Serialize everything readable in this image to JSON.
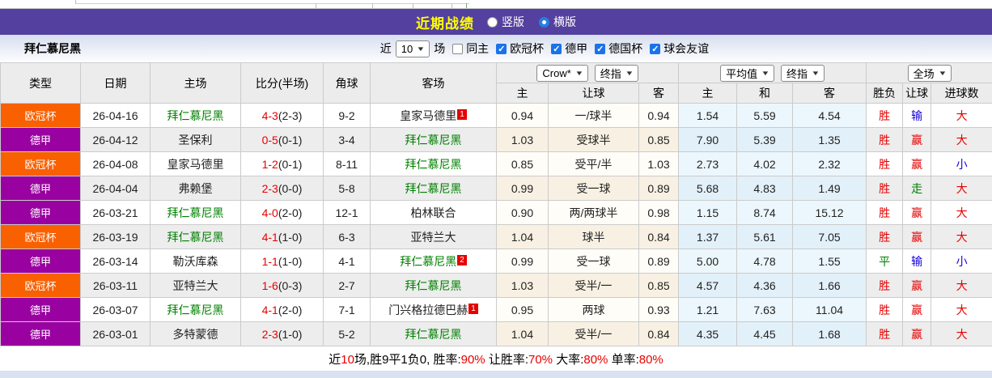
{
  "header": {
    "title": "近期战绩",
    "view_options": [
      {
        "label": "竖版",
        "selected": false
      },
      {
        "label": "横版",
        "selected": true
      }
    ]
  },
  "filter": {
    "team": "拜仁慕尼黑",
    "near": "近",
    "count": "10",
    "unit": "场",
    "same_home": {
      "label": "同主",
      "checked": false
    },
    "leagues": [
      {
        "label": "欧冠杯",
        "checked": true
      },
      {
        "label": "德甲",
        "checked": true
      },
      {
        "label": "德国杯",
        "checked": true
      },
      {
        "label": "球会友谊",
        "checked": true
      }
    ]
  },
  "table": {
    "selects": {
      "odds_source": "Crow*",
      "final1": "终指",
      "average": "平均值",
      "final2": "终指",
      "scope": "全场"
    },
    "main_columns": [
      "类型",
      "日期",
      "主场",
      "比分(半场)",
      "角球",
      "客场"
    ],
    "sub_columns": [
      "主",
      "让球",
      "客",
      "主",
      "和",
      "客",
      "胜负",
      "让球",
      "进球数"
    ],
    "rows": [
      {
        "league": "欧冠杯",
        "lg": "ucl",
        "date": "26-04-16",
        "home": "拜仁慕尼黑",
        "home_c": "green",
        "home_sup": "",
        "score": "4-3",
        "half": "(2-3)",
        "corner": "9-2",
        "away": "皇家马德里",
        "away_c": "",
        "away_sup": "1",
        "odds": [
          "0.94",
          "一/球半",
          "0.94"
        ],
        "avg": [
          "1.54",
          "5.59",
          "4.54"
        ],
        "res": [
          {
            "t": "胜",
            "c": "red"
          },
          {
            "t": "输",
            "c": "blue"
          },
          {
            "t": "大",
            "c": "red"
          }
        ]
      },
      {
        "league": "德甲",
        "lg": "bund",
        "date": "26-04-12",
        "home": "圣保利",
        "home_c": "",
        "home_sup": "",
        "score": "0-5",
        "half": "(0-1)",
        "corner": "3-4",
        "away": "拜仁慕尼黑",
        "away_c": "green",
        "away_sup": "",
        "odds": [
          "1.03",
          "受球半",
          "0.85"
        ],
        "avg": [
          "7.90",
          "5.39",
          "1.35"
        ],
        "res": [
          {
            "t": "胜",
            "c": "red"
          },
          {
            "t": "赢",
            "c": "red"
          },
          {
            "t": "大",
            "c": "red"
          }
        ]
      },
      {
        "league": "欧冠杯",
        "lg": "ucl",
        "date": "26-04-08",
        "home": "皇家马德里",
        "home_c": "",
        "home_sup": "",
        "score": "1-2",
        "half": "(0-1)",
        "corner": "8-11",
        "away": "拜仁慕尼黑",
        "away_c": "green",
        "away_sup": "",
        "odds": [
          "0.85",
          "受平/半",
          "1.03"
        ],
        "avg": [
          "2.73",
          "4.02",
          "2.32"
        ],
        "res": [
          {
            "t": "胜",
            "c": "red"
          },
          {
            "t": "赢",
            "c": "red"
          },
          {
            "t": "小",
            "c": "blue"
          }
        ]
      },
      {
        "league": "德甲",
        "lg": "bund",
        "date": "26-04-04",
        "home": "弗赖堡",
        "home_c": "",
        "home_sup": "",
        "score": "2-3",
        "half": "(0-0)",
        "corner": "5-8",
        "away": "拜仁慕尼黑",
        "away_c": "green",
        "away_sup": "",
        "odds": [
          "0.99",
          "受一球",
          "0.89"
        ],
        "avg": [
          "5.68",
          "4.83",
          "1.49"
        ],
        "res": [
          {
            "t": "胜",
            "c": "red"
          },
          {
            "t": "走",
            "c": "green"
          },
          {
            "t": "大",
            "c": "red"
          }
        ]
      },
      {
        "league": "德甲",
        "lg": "bund",
        "date": "26-03-21",
        "home": "拜仁慕尼黑",
        "home_c": "green",
        "home_sup": "",
        "score": "4-0",
        "half": "(2-0)",
        "corner": "12-1",
        "away": "柏林联合",
        "away_c": "",
        "away_sup": "",
        "odds": [
          "0.90",
          "两/两球半",
          "0.98"
        ],
        "avg": [
          "1.15",
          "8.74",
          "15.12"
        ],
        "res": [
          {
            "t": "胜",
            "c": "red"
          },
          {
            "t": "赢",
            "c": "red"
          },
          {
            "t": "大",
            "c": "red"
          }
        ]
      },
      {
        "league": "欧冠杯",
        "lg": "ucl",
        "date": "26-03-19",
        "home": "拜仁慕尼黑",
        "home_c": "green",
        "home_sup": "",
        "score": "4-1",
        "half": "(1-0)",
        "corner": "6-3",
        "away": "亚特兰大",
        "away_c": "",
        "away_sup": "",
        "odds": [
          "1.04",
          "球半",
          "0.84"
        ],
        "avg": [
          "1.37",
          "5.61",
          "7.05"
        ],
        "res": [
          {
            "t": "胜",
            "c": "red"
          },
          {
            "t": "赢",
            "c": "red"
          },
          {
            "t": "大",
            "c": "red"
          }
        ]
      },
      {
        "league": "德甲",
        "lg": "bund",
        "date": "26-03-14",
        "home": "勒沃库森",
        "home_c": "",
        "home_sup": "",
        "score": "1-1",
        "half": "(1-0)",
        "corner": "4-1",
        "away": "拜仁慕尼黑",
        "away_c": "green",
        "away_sup": "2",
        "odds": [
          "0.99",
          "受一球",
          "0.89"
        ],
        "avg": [
          "5.00",
          "4.78",
          "1.55"
        ],
        "res": [
          {
            "t": "平",
            "c": "green"
          },
          {
            "t": "输",
            "c": "blue"
          },
          {
            "t": "小",
            "c": "blue"
          }
        ]
      },
      {
        "league": "欧冠杯",
        "lg": "ucl",
        "date": "26-03-11",
        "home": "亚特兰大",
        "home_c": "",
        "home_sup": "",
        "score": "1-6",
        "half": "(0-3)",
        "corner": "2-7",
        "away": "拜仁慕尼黑",
        "away_c": "green",
        "away_sup": "",
        "odds": [
          "1.03",
          "受半/一",
          "0.85"
        ],
        "avg": [
          "4.57",
          "4.36",
          "1.66"
        ],
        "res": [
          {
            "t": "胜",
            "c": "red"
          },
          {
            "t": "赢",
            "c": "red"
          },
          {
            "t": "大",
            "c": "red"
          }
        ]
      },
      {
        "league": "德甲",
        "lg": "bund",
        "date": "26-03-07",
        "home": "拜仁慕尼黑",
        "home_c": "green",
        "home_sup": "",
        "score": "4-1",
        "half": "(2-0)",
        "corner": "7-1",
        "away": "门兴格拉德巴赫",
        "away_c": "",
        "away_sup": "1",
        "odds": [
          "0.95",
          "两球",
          "0.93"
        ],
        "avg": [
          "1.21",
          "7.63",
          "11.04"
        ],
        "res": [
          {
            "t": "胜",
            "c": "red"
          },
          {
            "t": "赢",
            "c": "red"
          },
          {
            "t": "大",
            "c": "red"
          }
        ]
      },
      {
        "league": "德甲",
        "lg": "bund",
        "date": "26-03-01",
        "home": "多特蒙德",
        "home_c": "",
        "home_sup": "",
        "score": "2-3",
        "half": "(1-0)",
        "corner": "5-2",
        "away": "拜仁慕尼黑",
        "away_c": "green",
        "away_sup": "",
        "odds": [
          "1.04",
          "受半/一",
          "0.84"
        ],
        "avg": [
          "4.35",
          "4.45",
          "1.68"
        ],
        "res": [
          {
            "t": "胜",
            "c": "red"
          },
          {
            "t": "赢",
            "c": "red"
          },
          {
            "t": "大",
            "c": "red"
          }
        ]
      }
    ]
  },
  "footer": {
    "parts": [
      {
        "t": "近",
        "c": "k"
      },
      {
        "t": "10",
        "c": "r"
      },
      {
        "t": "场,胜9平1负0, 胜率:",
        "c": "k"
      },
      {
        "t": "90%",
        "c": "r"
      },
      {
        "t": " 让胜率:",
        "c": "k"
      },
      {
        "t": "70%",
        "c": "r"
      },
      {
        "t": " 大率:",
        "c": "k"
      },
      {
        "t": "80%",
        "c": "r"
      },
      {
        "t": " 单率:",
        "c": "k"
      },
      {
        "t": "80%",
        "c": "r"
      }
    ]
  },
  "colors": {
    "bar_purple": "#54409e",
    "title_yellow": "#ffff00",
    "league_ucl_orange": "#f96000",
    "league_bundesliga_purple": "#9901a0",
    "team_green": "#008000",
    "score_red": "#e60000",
    "result_red": "#e60000",
    "result_blue": "#1500dc",
    "result_green": "#008000",
    "avg_col_blue": "#ecf7fd",
    "odds_col_cream": "#f8f1e3",
    "checkbox_blue": "#1a73e8"
  }
}
